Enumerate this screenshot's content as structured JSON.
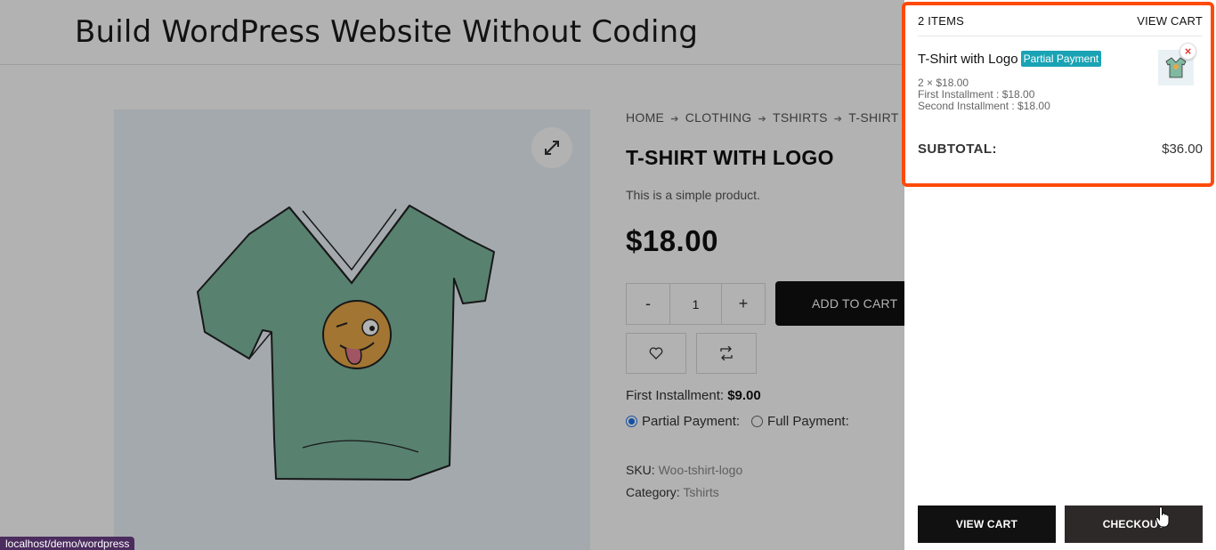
{
  "site": {
    "title": "Build WordPress Website Without Coding"
  },
  "breadcrumb": [
    "HOME",
    "CLOTHING",
    "TSHIRTS",
    "T-SHIRT WITH LOGO"
  ],
  "product": {
    "title": "T-SHIRT WITH LOGO",
    "short_description": "This is a simple product.",
    "price": "$18.00",
    "quantity": "1",
    "qty_minus": "-",
    "qty_plus": "+",
    "add_to_cart_label": "ADD TO CART",
    "first_installment_label": "First Installment:",
    "first_installment_value": "$9.00",
    "payment_options": [
      {
        "label": "Partial Payment:",
        "selected": true
      },
      {
        "label": "Full Payment:",
        "selected": false
      }
    ],
    "sku_label": "SKU:",
    "sku_value": "Woo-tshirt-logo",
    "category_label": "Category:",
    "category_value": "Tshirts"
  },
  "status_bar": {
    "url": "localhost/demo/wordpress"
  },
  "mini_cart": {
    "item_count": "2 ITEMS",
    "view_cart_link": "VIEW CART",
    "item": {
      "name": "T-Shirt with Logo",
      "badge": "Partial Payment",
      "qty_price": "2 × $18.00",
      "first_installment": "First Installment : $18.00",
      "second_installment": "Second Installment : $18.00",
      "remove": "×"
    },
    "subtotal_label": "SUBTOTAL:",
    "subtotal_value": "$36.00",
    "view_cart_button": "VIEW CART",
    "checkout_button": "CHECKOUT"
  },
  "colors": {
    "highlight_border": "#ff4a0a",
    "badge_bg": "#1aa3b4",
    "button_dark": "#111111",
    "tshirt": "#7fb9a0"
  }
}
